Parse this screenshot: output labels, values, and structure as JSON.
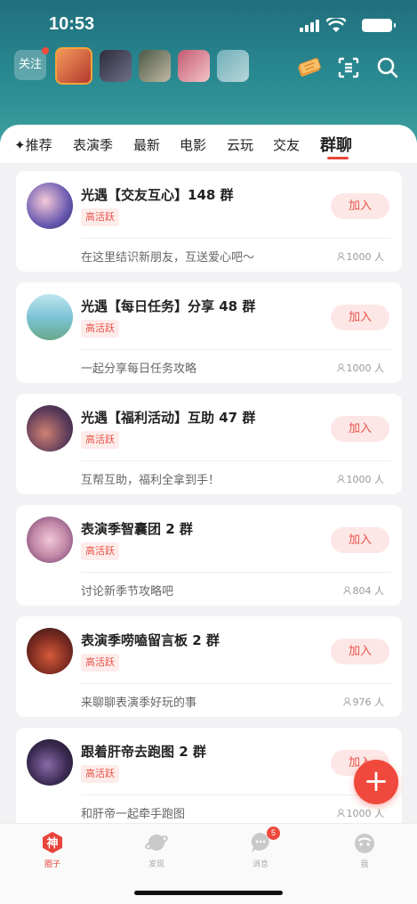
{
  "status": {
    "time": "10:53"
  },
  "header": {
    "follow_label": "关注",
    "icons": [
      "ticket-icon",
      "scan-icon",
      "search-icon"
    ]
  },
  "tabs": [
    {
      "label": "✦推荐"
    },
    {
      "label": "表演季"
    },
    {
      "label": "最新"
    },
    {
      "label": "电影"
    },
    {
      "label": "云玩"
    },
    {
      "label": "交友"
    },
    {
      "label": "群聊",
      "active": true
    }
  ],
  "groups": [
    {
      "title": "光遇【交友互心】148 群",
      "tag": "高活跃",
      "join": "加入",
      "desc": "在这里结识新朋友，互送爱心吧～",
      "count": "1000 人"
    },
    {
      "title": "光遇【每日任务】分享 48 群",
      "tag": "高活跃",
      "join": "加入",
      "desc": "一起分享每日任务攻略",
      "count": "1000 人"
    },
    {
      "title": "光遇【福利活动】互助 47 群",
      "tag": "高活跃",
      "join": "加入",
      "desc": "互帮互助，福利全拿到手！",
      "count": "1000 人"
    },
    {
      "title": "表演季智囊团 2 群",
      "tag": "高活跃",
      "join": "加入",
      "desc": "讨论新季节攻略吧",
      "count": "804 人"
    },
    {
      "title": "表演季唠嗑留言板 2 群",
      "tag": "高活跃",
      "join": "加入",
      "desc": "来聊聊表演季好玩的事",
      "count": "976 人"
    },
    {
      "title": "跟着肝帝去跑图 2 群",
      "tag": "高活跃",
      "join": "加入",
      "desc": "和肝帝一起牵手跑图",
      "count": "1000 人"
    }
  ],
  "fab": {
    "label": "+"
  },
  "bottom_nav": [
    {
      "label": "圈子",
      "icon": "shen-icon",
      "active": true
    },
    {
      "label": "发现",
      "icon": "planet-icon"
    },
    {
      "label": "消息",
      "icon": "message-icon",
      "badge": "5"
    },
    {
      "label": "我",
      "icon": "face-icon"
    }
  ],
  "colors": {
    "accent": "#e8443a",
    "header_bg": "#2a8a91",
    "tag_bg": "#fdecea"
  }
}
